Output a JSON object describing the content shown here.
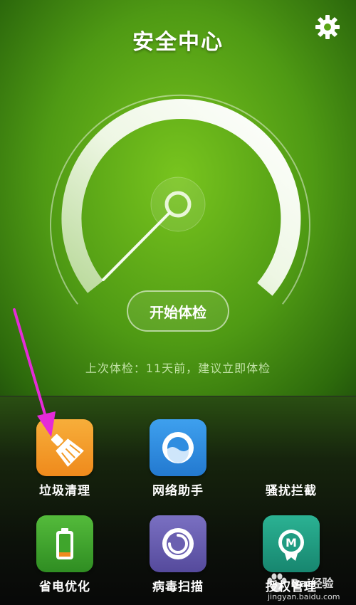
{
  "header": {
    "title": "安全中心",
    "settings_icon": "gear-icon"
  },
  "gauge": {
    "level": 0.0
  },
  "start_button": {
    "label": "开始体检"
  },
  "status": {
    "last_check": "上次体检：11天前，建议立即体检"
  },
  "tools": [
    {
      "label": "垃圾清理",
      "icon": "broom-icon",
      "color": "#f39a25"
    },
    {
      "label": "网络助手",
      "icon": "network-icon",
      "color": "#2f8de0"
    },
    {
      "label": "骚扰拦截",
      "icon": "",
      "color": ""
    },
    {
      "label": "省电优化",
      "icon": "battery-icon",
      "color": "#3fa52c"
    },
    {
      "label": "病毒扫描",
      "icon": "virus-scan-icon",
      "color": "#6a5fb0"
    },
    {
      "label": "授权管理",
      "icon": "permission-icon",
      "color": "#1f9c82"
    }
  ],
  "watermark": {
    "text": "Bai经验",
    "url": "jingyan.baidu.com"
  },
  "annotation": {
    "arrow_color": "#e52ad8"
  }
}
